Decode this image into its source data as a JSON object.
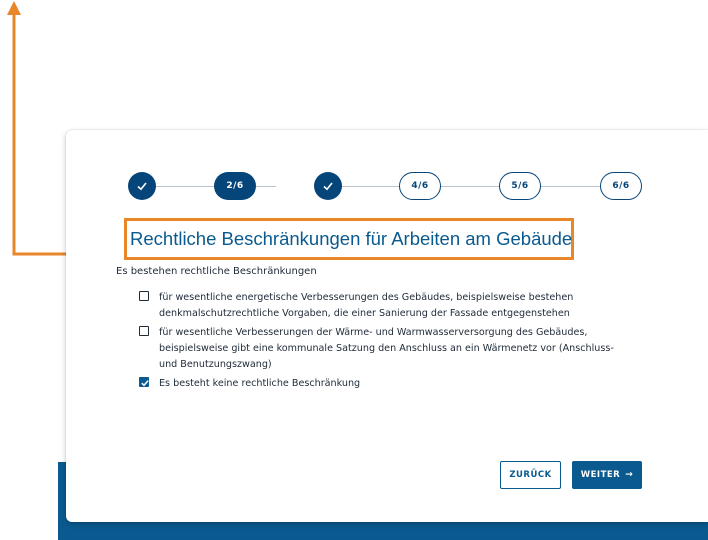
{
  "stepper": {
    "steps": [
      {
        "state": "done",
        "label": ""
      },
      {
        "state": "current",
        "label": "2/6"
      },
      {
        "state": "done",
        "label": ""
      },
      {
        "state": "todo",
        "label": "4/6"
      },
      {
        "state": "todo",
        "label": "5/6"
      },
      {
        "state": "todo",
        "label": "6/6"
      }
    ]
  },
  "page": {
    "title": "Rechtliche Beschränkungen für Arbeiten am Gebäude",
    "question": "Es bestehen rechtliche Beschränkungen"
  },
  "options": [
    {
      "label": "für wesentliche energetische Verbesserungen des Gebäudes, beispielsweise bestehen denkmalschutzrechtliche Vorgaben, die einer Sanierung der Fassade entgegenstehen",
      "checked": false
    },
    {
      "label": "für wesentliche Verbesserungen der Wärme- und Warmwasserversorgung des Gebäudes, beispielsweise gibt eine kommunale Satzung den Anschluss an ein Wärmenetz vor (Anschluss- und Benutzungszwang)",
      "checked": false
    },
    {
      "label": "Es besteht keine rechtliche Beschränkung",
      "checked": true
    }
  ],
  "buttons": {
    "back_label": "ZURÜCK",
    "next_label": "WEITER",
    "next_arrow": "→"
  },
  "colors": {
    "primary": "#0a5a8f",
    "stepper_dark": "#06457a",
    "highlight": "#e8862a"
  },
  "icons": {
    "step_done": "check-icon",
    "next": "arrow-right-icon",
    "annotation": "arrow-up-icon"
  }
}
